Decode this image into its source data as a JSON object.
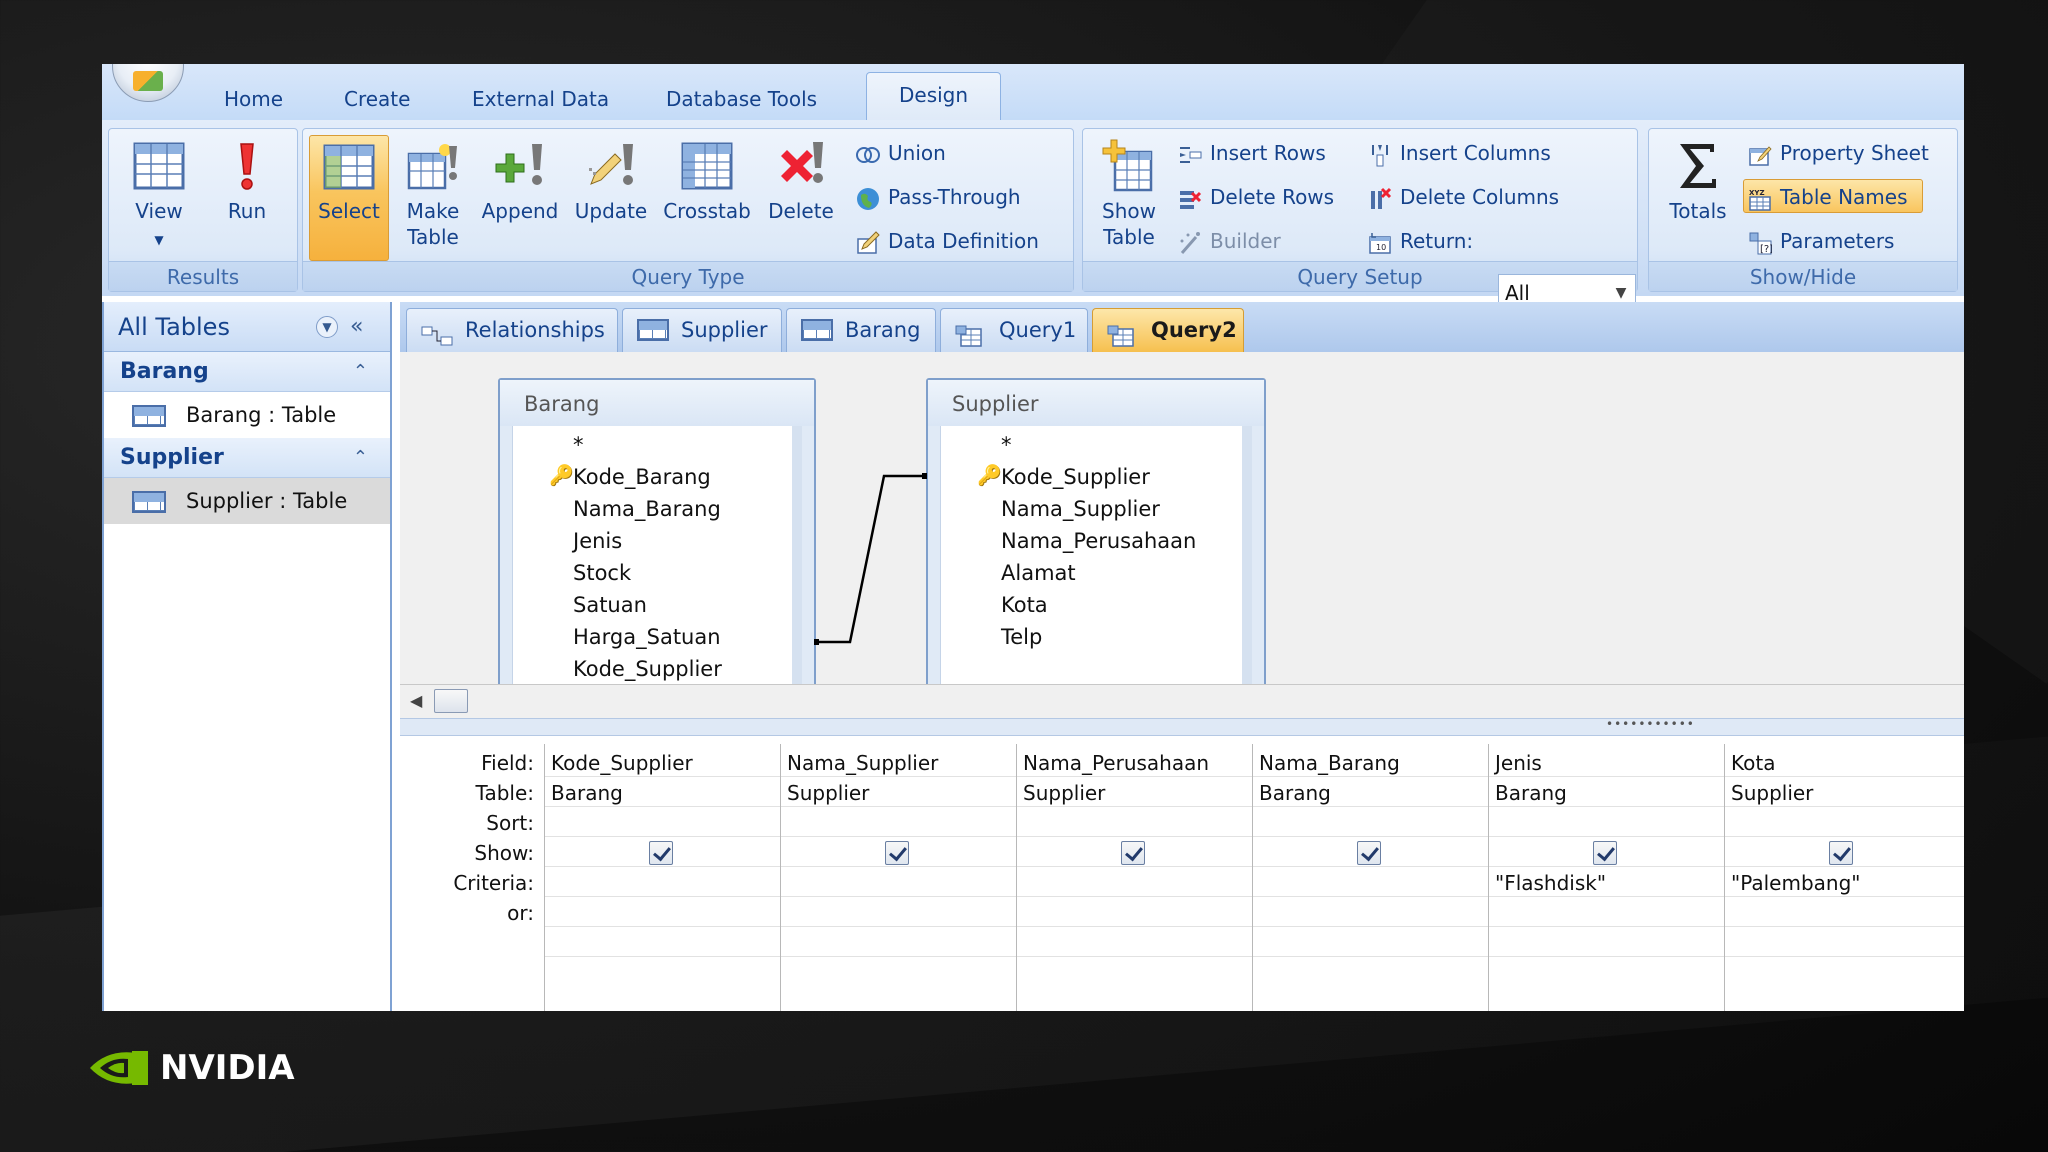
{
  "ribbon_tabs": [
    "Home",
    "Create",
    "External Data",
    "Database Tools",
    "Design"
  ],
  "active_tab": "Design",
  "groups": {
    "results": {
      "label": "Results",
      "view": "View",
      "run": "Run"
    },
    "query_type": {
      "label": "Query Type",
      "select": "Select",
      "make_table_1": "Make",
      "make_table_2": "Table",
      "append": "Append",
      "update": "Update",
      "crosstab": "Crosstab",
      "delete": "Delete",
      "union": "Union",
      "pass_through": "Pass-Through",
      "data_definition": "Data Definition"
    },
    "query_setup": {
      "label": "Query Setup",
      "show_table_1": "Show",
      "show_table_2": "Table",
      "insert_rows": "Insert Rows",
      "delete_rows": "Delete Rows",
      "builder": "Builder",
      "insert_columns": "Insert Columns",
      "delete_columns": "Delete Columns",
      "return_label": "Return:",
      "return_value": "All"
    },
    "show_hide": {
      "label": "Show/Hide",
      "totals": "Totals",
      "property_sheet": "Property Sheet",
      "table_names": "Table Names",
      "parameters": "Parameters"
    }
  },
  "nav": {
    "title": "All Tables",
    "groups": [
      {
        "name": "Barang",
        "items": [
          "Barang : Table"
        ]
      },
      {
        "name": "Supplier",
        "items": [
          "Supplier : Table"
        ]
      }
    ]
  },
  "doc_tabs": [
    "Relationships",
    "Supplier",
    "Barang",
    "Query1",
    "Query2"
  ],
  "active_doc_tab": "Query2",
  "tables": {
    "barang": {
      "title": "Barang",
      "fields": [
        "*",
        "Kode_Barang",
        "Nama_Barang",
        "Jenis",
        "Stock",
        "Satuan",
        "Harga_Satuan",
        "Kode_Supplier"
      ]
    },
    "supplier": {
      "title": "Supplier",
      "fields": [
        "*",
        "Kode_Supplier",
        "Nama_Supplier",
        "Nama_Perusahaan",
        "Alamat",
        "Kota",
        "Telp"
      ]
    }
  },
  "grid": {
    "row_labels": [
      "Field:",
      "Table:",
      "Sort:",
      "Show:",
      "Criteria:",
      "or:"
    ],
    "columns": [
      {
        "field": "Kode_Supplier",
        "table": "Barang",
        "sort": "",
        "show": true,
        "criteria": "",
        "or": ""
      },
      {
        "field": "Nama_Supplier",
        "table": "Supplier",
        "sort": "",
        "show": true,
        "criteria": "",
        "or": ""
      },
      {
        "field": "Nama_Perusahaan",
        "table": "Supplier",
        "sort": "",
        "show": true,
        "criteria": "",
        "or": ""
      },
      {
        "field": "Nama_Barang",
        "table": "Barang",
        "sort": "",
        "show": true,
        "criteria": "",
        "or": ""
      },
      {
        "field": "Jenis",
        "table": "Barang",
        "sort": "",
        "show": true,
        "criteria": "\"Flashdisk\"",
        "or": ""
      },
      {
        "field": "Kota",
        "table": "Supplier",
        "sort": "",
        "show": true,
        "criteria": "\"Palembang\"",
        "or": ""
      }
    ]
  },
  "brand": "NVIDIA",
  "colors": {
    "accent": "#15428b",
    "selected": "#f9c55e",
    "nvidia_green": "#76b900"
  }
}
